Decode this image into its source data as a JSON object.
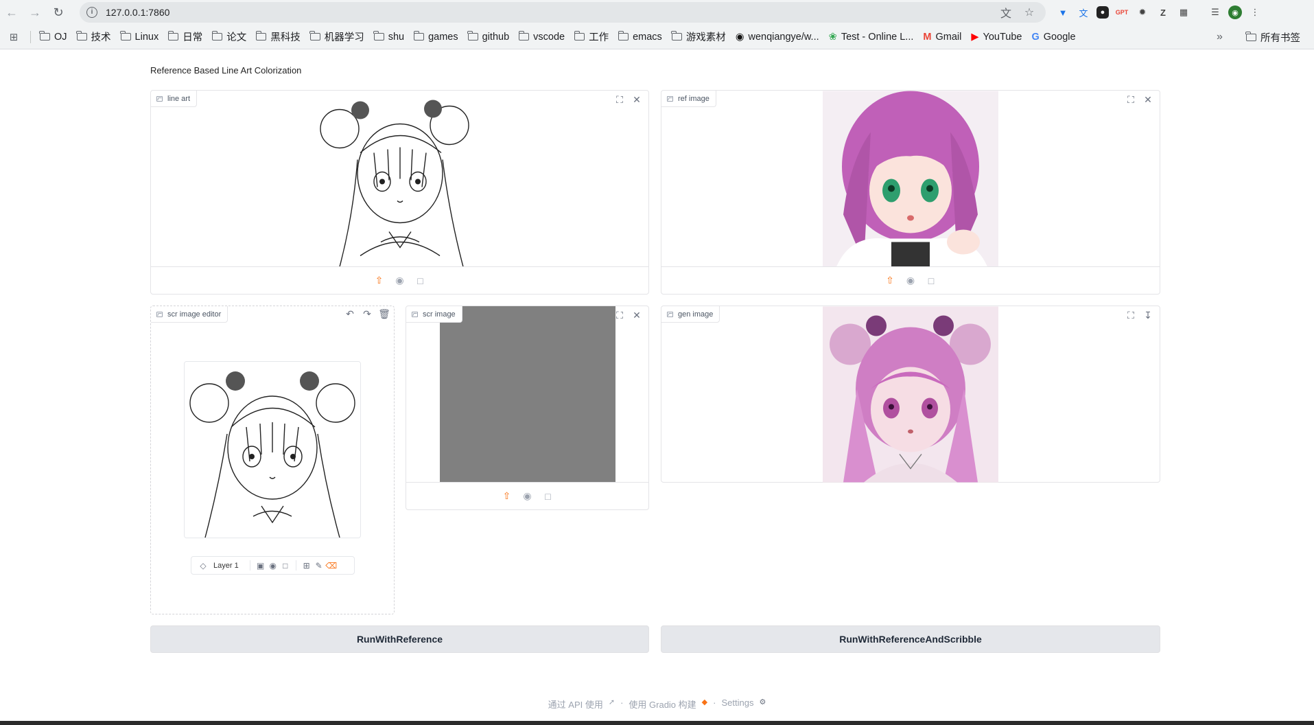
{
  "browser": {
    "url": "127.0.0.1:7860",
    "bookmarks": [
      {
        "type": "folder",
        "label": "OJ"
      },
      {
        "type": "folder",
        "label": "技术"
      },
      {
        "type": "folder",
        "label": "Linux"
      },
      {
        "type": "folder",
        "label": "日常"
      },
      {
        "type": "folder",
        "label": "论文"
      },
      {
        "type": "folder",
        "label": "黑科技"
      },
      {
        "type": "folder",
        "label": "机器学习"
      },
      {
        "type": "folder",
        "label": "shu"
      },
      {
        "type": "folder",
        "label": "games"
      },
      {
        "type": "folder",
        "label": "github"
      },
      {
        "type": "folder",
        "label": "vscode"
      },
      {
        "type": "folder",
        "label": "工作"
      },
      {
        "type": "folder",
        "label": "emacs"
      },
      {
        "type": "folder",
        "label": "游戏素材"
      },
      {
        "type": "link",
        "label": "wenqiangye/w...",
        "icon": "github-icon"
      },
      {
        "type": "link",
        "label": "Test - Online L...",
        "icon": "leaf-icon"
      },
      {
        "type": "link",
        "label": "Gmail",
        "icon": "gmail-icon"
      },
      {
        "type": "link",
        "label": "YouTube",
        "icon": "youtube-icon"
      },
      {
        "type": "link",
        "label": "Google",
        "icon": "google-icon"
      }
    ],
    "bookmarks_more": "»",
    "all_bookmarks": "所有书签"
  },
  "app": {
    "title": "Reference Based Line Art Colorization",
    "line_art_label": "line art",
    "ref_image_label": "ref image",
    "scr_editor_label": "scr image editor",
    "scr_image_label": "scr image",
    "gen_image_label": "gen image",
    "layer_label": "Layer 1",
    "run_reference": "RunWithReference",
    "run_reference_scribble": "RunWithReferenceAndScribble"
  },
  "footer": {
    "api": "通过 API 使用",
    "gradio": "使用 Gradio 构建",
    "settings": "Settings"
  },
  "colors": {
    "accent": "#f97316",
    "button_bg": "#e5e7eb",
    "scribble_gray": "#808080"
  }
}
